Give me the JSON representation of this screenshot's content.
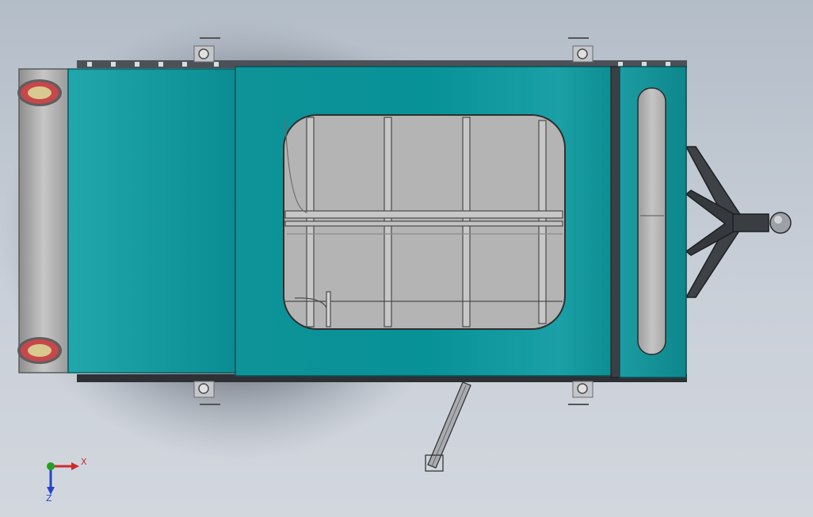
{
  "viewport": {
    "view": "top",
    "background_color": "#c4ccd5"
  },
  "model": {
    "type": "utility-trailer",
    "body_color": "#1a9aa0",
    "frame_color": "#7d7d7d",
    "window_color": "#b5b5b5",
    "tail_light_color": "#c8474b",
    "hitch_color": "#3c3c3c"
  },
  "triad": {
    "x_label": "X",
    "z_label": "Z",
    "x_color": "#cc2b2b",
    "y_color": "#22a022",
    "z_color": "#2247c8"
  }
}
